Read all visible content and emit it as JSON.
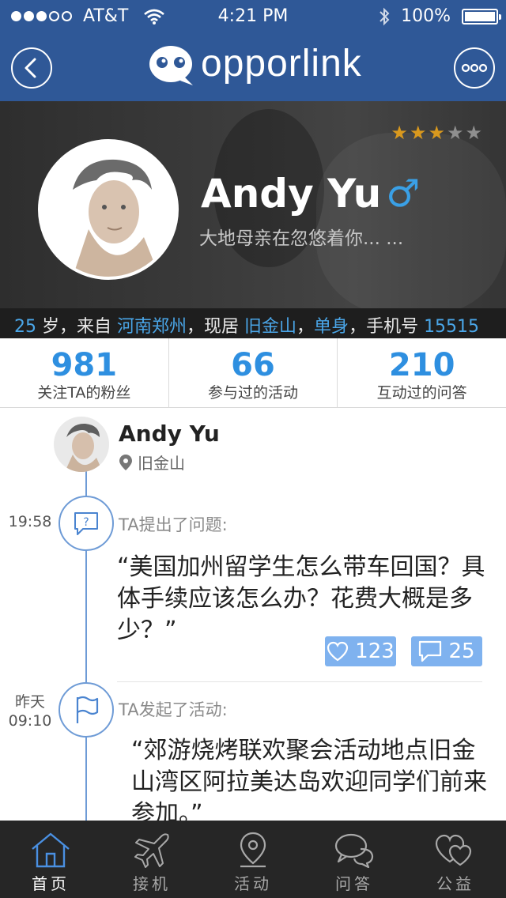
{
  "status_bar": {
    "carrier": "AT&T",
    "time": "4:21 PM",
    "battery": "100%",
    "signal_bars_filled": 3,
    "signal_bars_total": 5
  },
  "nav": {
    "logo_text": "opporlink",
    "back_icon": "back-arrow-icon",
    "more_icon": "more-dots-icon",
    "brand_color": "#2f5897"
  },
  "profile": {
    "name": "Andy Yu",
    "gender_symbol": "♂",
    "signature": "大地母亲在忽悠着你... ...",
    "rating": 3,
    "rating_max": 5,
    "info": {
      "age": "25",
      "age_suffix": " 岁，来自 ",
      "hometown": "河南郑州",
      "mid": "，现居 ",
      "city": "旧金山",
      "sep": "，",
      "relationship": "单身",
      "phone_label": "，手机号 ",
      "phone": "15515"
    }
  },
  "stats": [
    {
      "value": "981",
      "label": "关注TA的粉丝"
    },
    {
      "value": "66",
      "label": "参与过的活动"
    },
    {
      "value": "210",
      "label": "互动过的问答"
    }
  ],
  "timeline": {
    "user_name": "Andy Yu",
    "user_location": "旧金山",
    "items": [
      {
        "time_line1": "19:58",
        "time_line2": "",
        "icon": "question-bubble-icon",
        "caption": "TA提出了问题:",
        "content": "“美国加州留学生怎么带车回国？具体手续应该怎么办？花费大概是多少？”",
        "likes": "123",
        "comments": "25"
      },
      {
        "time_line1": "昨天",
        "time_line2": "09:10",
        "icon": "flag-icon",
        "caption": "TA发起了活动:",
        "content": "“郊游烧烤联欢聚会活动地点旧金山湾区阿拉美达岛欢迎同学们前来参加。”"
      }
    ]
  },
  "tabbar": {
    "tabs": [
      {
        "label": "首页",
        "icon": "home-icon",
        "active": true
      },
      {
        "label": "接机",
        "icon": "airplane-icon",
        "active": false
      },
      {
        "label": "活动",
        "icon": "location-pin-icon",
        "active": false
      },
      {
        "label": "问答",
        "icon": "chat-bubbles-icon",
        "active": false
      },
      {
        "label": "公益",
        "icon": "hearts-icon",
        "active": false
      }
    ]
  },
  "colors": {
    "accent": "#2e8fe0",
    "highlight": "#4aa6e8",
    "star": "#d9991e",
    "button": "#7fb2ef",
    "timeline": "#6e9bd6"
  }
}
